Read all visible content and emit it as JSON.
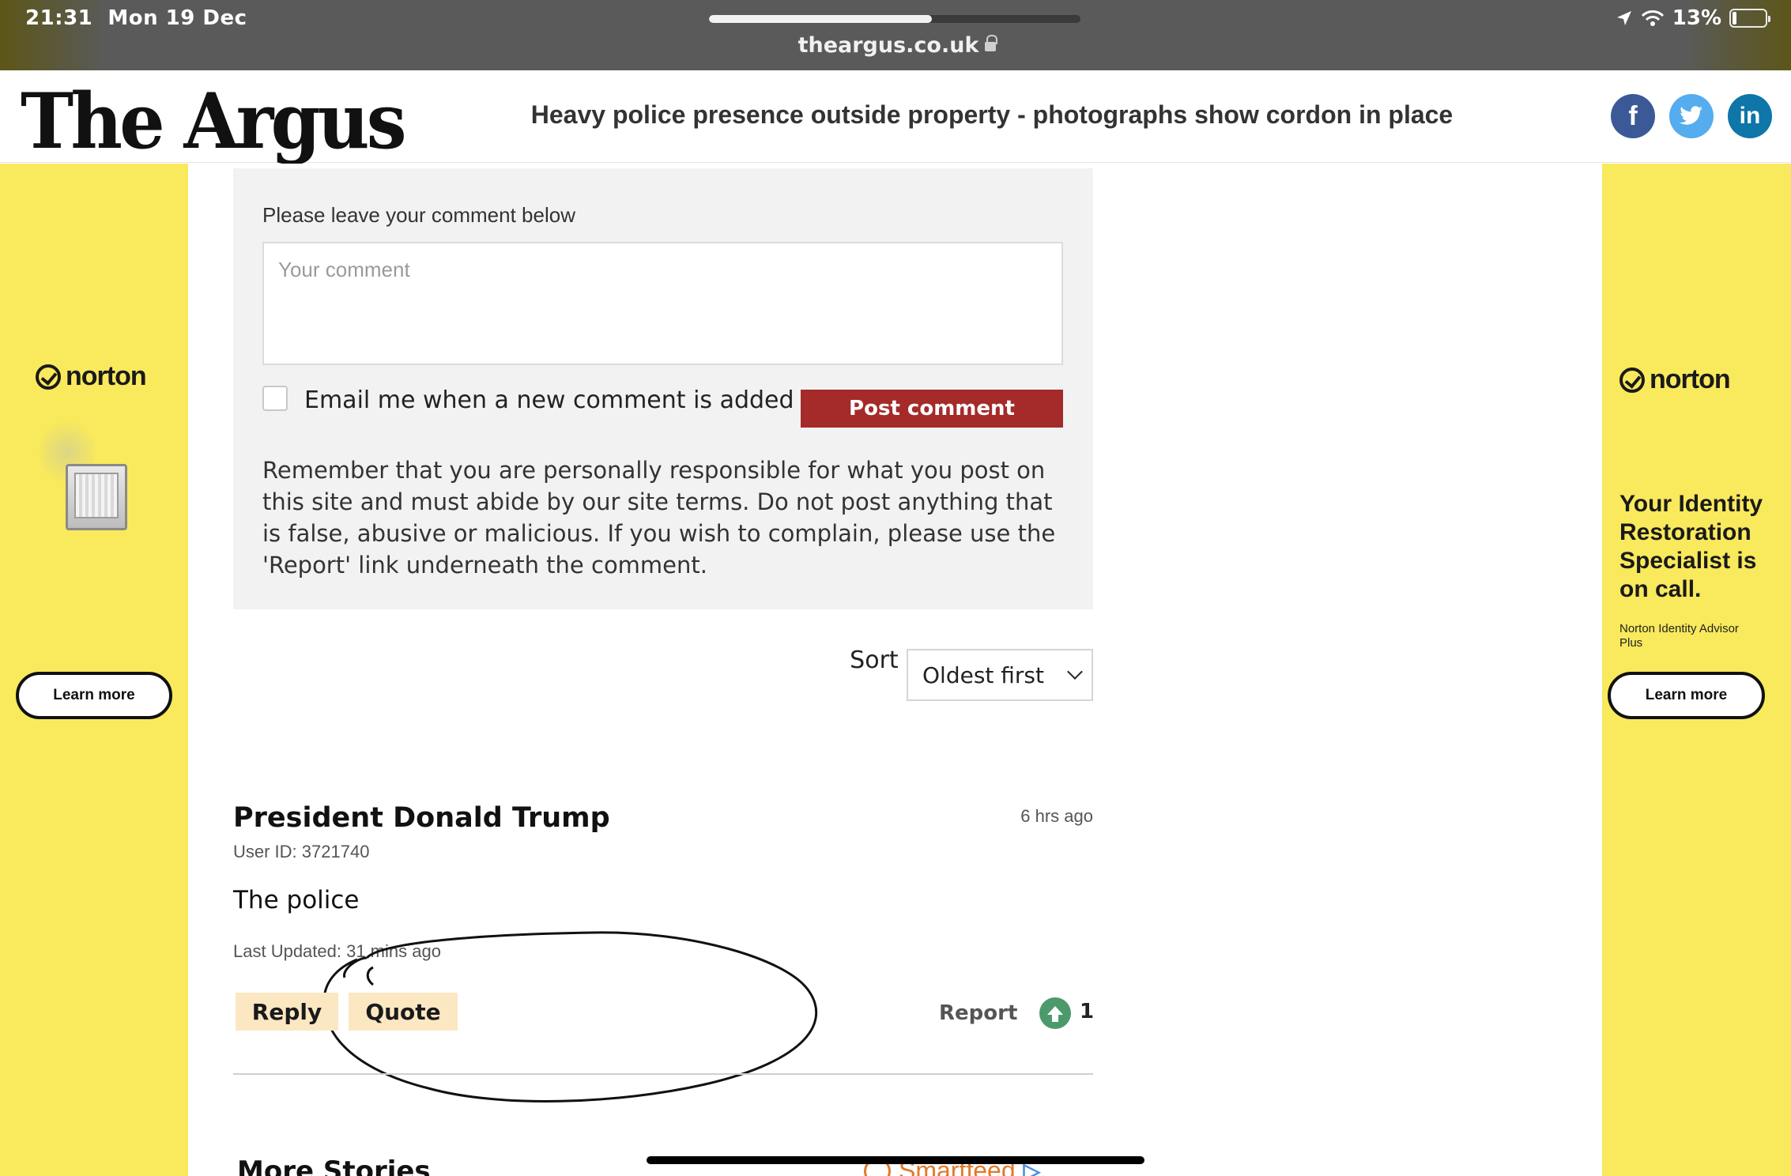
{
  "status_bar": {
    "time": "21:31",
    "date": "Mon 19 Dec",
    "url": "theargus.co.uk",
    "battery": "13%",
    "battery_level": 0.13,
    "load_progress": 0.6
  },
  "header": {
    "logo": "The Argus",
    "headline": "Heavy police presence outside property - photographs show cordon in place",
    "social": {
      "facebook": "f",
      "twitter": "t",
      "linkedin": "in"
    }
  },
  "ad_left": {
    "brand": "norton",
    "cta": "Learn more"
  },
  "ad_right": {
    "brand": "norton",
    "title": "Your Identity Restoration Specialist is on call.",
    "subtitle": "Norton Identity Advisor Plus",
    "cta": "Learn more"
  },
  "comment_form": {
    "label": "Please leave your comment below",
    "placeholder": "Your comment",
    "email_label": "Email me when a new comment is added",
    "post_label": "Post comment",
    "terms": "Remember that you are personally responsible for what you post on this site and must abide by our site terms. Do not post anything that is false, abusive or malicious. If you wish to complain, please use the 'Report' link underneath the comment."
  },
  "sort": {
    "label": "Sort by",
    "selected": "Oldest first"
  },
  "comment": {
    "author": "President Donald Trump",
    "user_id": "User ID: 3721740",
    "posted": "6 hrs ago",
    "body": "The police",
    "updated": "Last Updated: 31 mins ago",
    "reply_label": "Reply",
    "quote_label": "Quote",
    "report_label": "Report",
    "votes": "1"
  },
  "more_stories": {
    "title": "More Stories",
    "provider": "Smartfeed"
  },
  "colors": {
    "ad_yellow": "#f9e95c",
    "post_button": "#a52a2a",
    "soft_button": "#fce7c3",
    "upvote": "#4c9a6b"
  },
  "icons": [
    "lock-icon",
    "location-arrow-icon",
    "wifi-icon",
    "battery-icon",
    "facebook-icon",
    "twitter-icon",
    "linkedin-icon",
    "norton-check-icon",
    "chevron-down-icon",
    "upvote-icon"
  ]
}
